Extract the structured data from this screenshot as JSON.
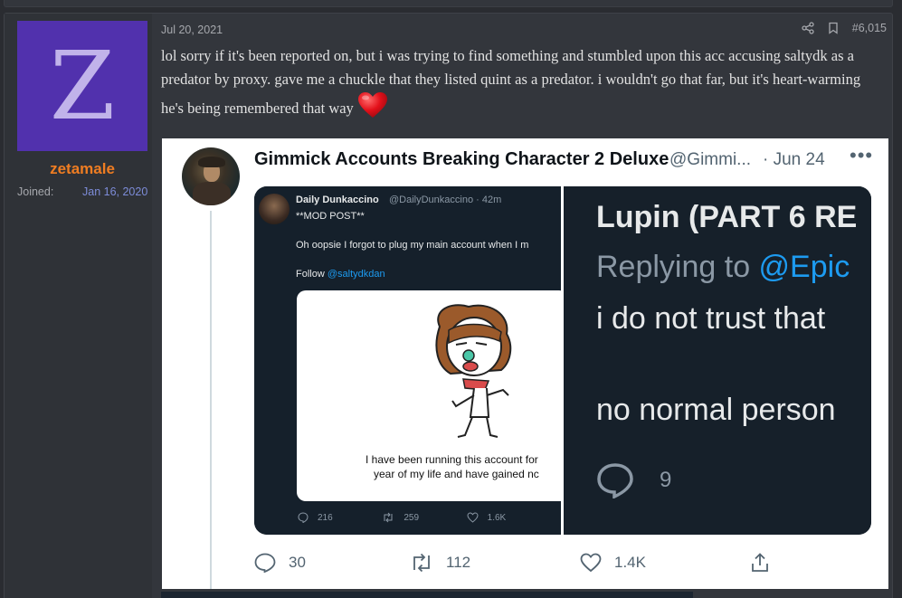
{
  "post": {
    "date": "Jul 20, 2021",
    "number": "#6,015",
    "text": "lol sorry if it's been reported on, but i was trying to find something and stumbled upon this acc accusing saltydk as a predator by proxy. gave me a chuckle that they listed quint as a predator. i wouldn't go that far, but it's heart-warming he's being remembered that way"
  },
  "user": {
    "avatar_letter": "Z",
    "avatar_color": "#5131ad",
    "name": "zetamale",
    "name_color": "#f07d22",
    "joined_label": "Joined:",
    "joined_value": "Jan 16, 2020"
  },
  "tweet": {
    "name": "Gimmick Accounts Breaking Character 2 Deluxe",
    "handle": "@Gimmi...",
    "date": "· Jun 24",
    "more": "•••",
    "replies": "30",
    "retweets": "112",
    "likes": "1.4K",
    "media_left": {
      "name": "Daily Dunkaccino",
      "handle": "@DailyDunkaccino · 42m",
      "mod": "**MOD POST**",
      "line1": "Oh oopsie I forgot to plug my main account when I m",
      "follow_prefix": "Follow ",
      "follow_link": "@saltydkdan",
      "caption1": "I have been running this account for",
      "caption2": "year of my life and have gained nc",
      "replies": "216",
      "retweets": "259",
      "likes": "1.6K"
    },
    "media_right": {
      "name": "Lupin (PART 6 RE",
      "reply_prefix": "Replying to ",
      "reply_handle": "@Epic",
      "line1": "i do not trust that",
      "line2": "no normal person",
      "replies": "9"
    }
  },
  "colors": {
    "page_bg": "#2a2c31",
    "post_bg": "#33363c",
    "link_blue": "#1d9bf0",
    "joined_blue": "#7d8cd8"
  }
}
